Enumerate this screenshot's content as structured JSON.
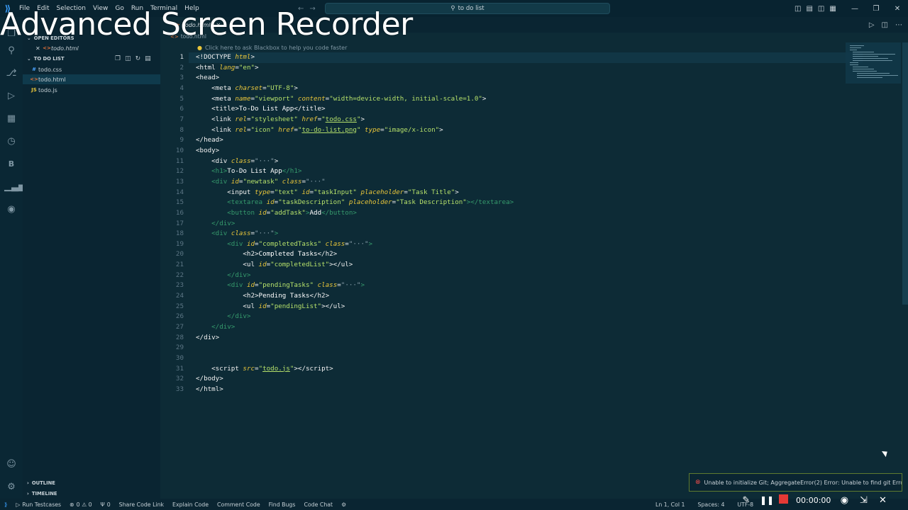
{
  "overlay": {
    "recorder_title": "Advanced Screen Recorder"
  },
  "menu": [
    "File",
    "Edit",
    "Selection",
    "View",
    "Go",
    "Run",
    "Terminal",
    "Help"
  ],
  "command_center": {
    "text": "to do list"
  },
  "icons": {
    "search": "search-icon",
    "source_control": "source-control-icon",
    "run_debug": "run-debug-icon",
    "extensions": "extensions-icon",
    "accounts": "accounts-icon",
    "settings": "gear-icon"
  },
  "sidebar": {
    "open_editors": "OPEN EDITORS",
    "open_editor_file": "todo.html",
    "folder": "TO DO LIST",
    "files": [
      {
        "name": "todo.css",
        "type": "css",
        "badge": "#"
      },
      {
        "name": "todo.html",
        "type": "html",
        "badge": "<>"
      },
      {
        "name": "todo.js",
        "type": "js",
        "badge": "JS"
      }
    ],
    "outline": "OUTLINE",
    "timeline": "TIMELINE"
  },
  "tabs": [
    {
      "label": "todo.html"
    }
  ],
  "breadcrumb": "todo.html",
  "editor": {
    "hint": "Click here to ask Blackbox to help you code faster",
    "current_line": 1
  },
  "toast": {
    "message": "Unable to initialize Git; AggregateError(2) Error: Unable to find git Erro..."
  },
  "status": {
    "left": [
      {
        "label": "Run Testcases"
      },
      {
        "label": "0 ⚠ 0"
      },
      {
        "label": "0"
      },
      {
        "label": "Share Code Link"
      },
      {
        "label": "Explain Code"
      },
      {
        "label": "Comment Code"
      },
      {
        "label": "Find Bugs"
      },
      {
        "label": "Code Chat"
      }
    ],
    "position": "Ln 1, Col 1",
    "spaces": "Spaces: 4",
    "encoding": "UTF-8"
  },
  "recorder": {
    "time": "00:00:00"
  },
  "colors": {
    "background": "#0d2b36",
    "accent": "#3aa0ff",
    "error": "#f14c4c",
    "record": "#e53935"
  }
}
